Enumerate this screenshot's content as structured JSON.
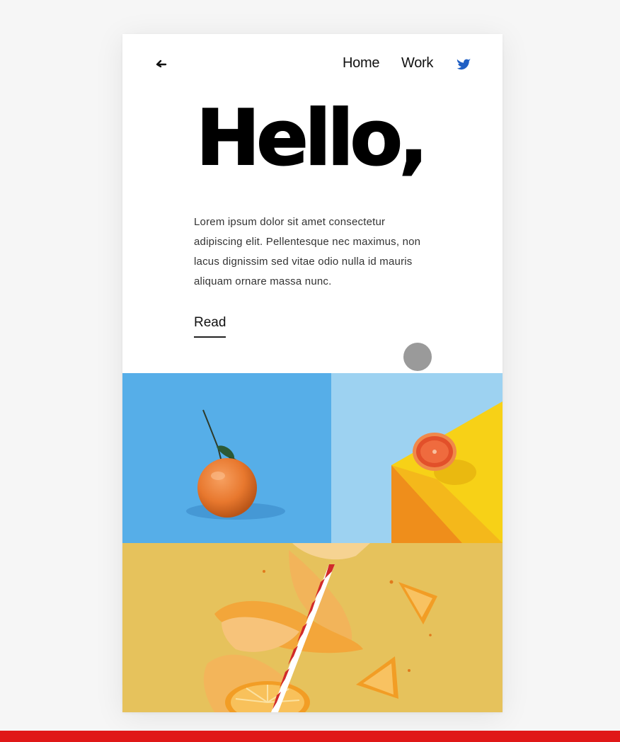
{
  "nav": {
    "back_icon": "back-arrow-icon",
    "links": [
      "Home",
      "Work"
    ],
    "social_icon": "twitter-bird-icon"
  },
  "hero": {
    "title": "Hello,",
    "intro": "Lorem ipsum dolor sit amet consectetur adipiscing elit. Pellentesque nec maximus, non lacus dignissim sed vitae odio nulla id mauris aliquam ornare massa nunc.",
    "read_more": "Read"
  },
  "gallery": {
    "images": [
      {
        "subject": "tangerine with leaves on blue background"
      },
      {
        "subject": "sliced grapefruit on yellow block against blue"
      },
      {
        "subject": "orange peel and slices falling with striped straw on yellow"
      }
    ]
  },
  "colors": {
    "accent_blue": "#1f5fc4",
    "bottom_bar": "#e01818",
    "photo_blue": "#56aee8",
    "photo_yellow": "#e6c25c"
  }
}
